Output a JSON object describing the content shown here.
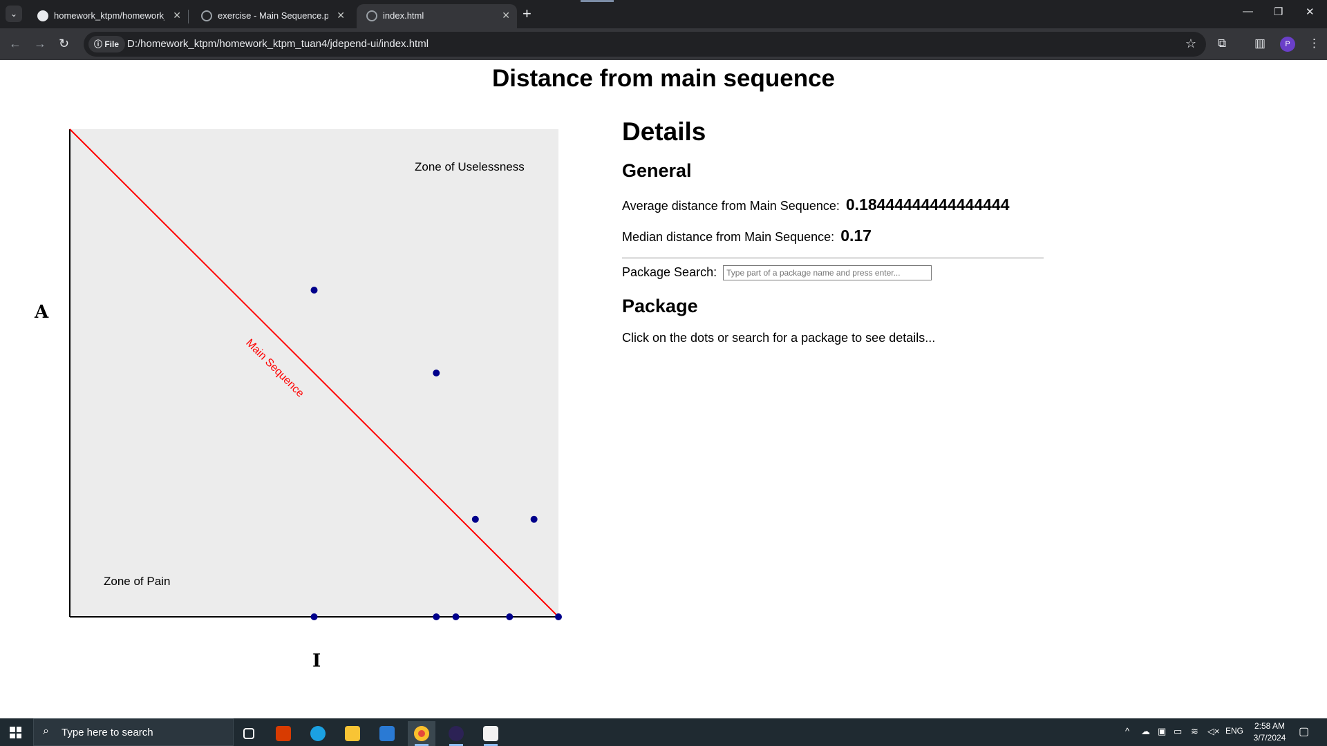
{
  "browser": {
    "tabs": [
      {
        "title": "homework_ktpm/homework_kt",
        "icon": "github-icon",
        "close": "✕"
      },
      {
        "title": "exercise - Main Sequence.pdf",
        "icon": "globe-icon",
        "close": "✕"
      },
      {
        "title": "index.html",
        "icon": "globe-icon",
        "close": "✕",
        "active": true
      }
    ],
    "new_tab": "+",
    "address": {
      "scheme_chip": "File",
      "url": "D:/homework_ktpm/homework_ktpm_tuan4/jdepend-ui/index.html"
    },
    "profile_initial": "P"
  },
  "page": {
    "title": "Distance from main sequence",
    "axis_y_label": "A",
    "axis_x_label": "I"
  },
  "chart_data": {
    "type": "scatter",
    "title": "",
    "xlabel": "I",
    "ylabel": "A",
    "xlim": [
      0,
      1
    ],
    "ylim": [
      0,
      1
    ],
    "grid": false,
    "background_color": "#ececec",
    "point_color": "#00008b",
    "line_color": "#ff0000",
    "annotations": [
      "Zone of Uselessness",
      "Zone of Pain",
      "Main Sequence"
    ],
    "reference_line": {
      "name": "Main Sequence",
      "from": [
        0,
        1
      ],
      "to": [
        1,
        0
      ]
    },
    "points": [
      {
        "x": 0.5,
        "y": 0.67
      },
      {
        "x": 0.75,
        "y": 0.5
      },
      {
        "x": 0.83,
        "y": 0.2
      },
      {
        "x": 0.95,
        "y": 0.2
      },
      {
        "x": 0.5,
        "y": 0.0
      },
      {
        "x": 0.75,
        "y": 0.0
      },
      {
        "x": 0.79,
        "y": 0.0
      },
      {
        "x": 0.9,
        "y": 0.0
      },
      {
        "x": 1.0,
        "y": 0.0
      }
    ]
  },
  "details": {
    "heading": "Details",
    "general_heading": "General",
    "avg_label": "Average distance from Main Sequence:",
    "avg_value": "0.18444444444444444",
    "median_label": "Median distance from Main Sequence:",
    "median_value": "0.17",
    "search_label": "Package Search:",
    "search_placeholder": "Type part of a package name and press enter...",
    "package_heading": "Package",
    "package_hint": "Click on the dots or search for a package to see details..."
  },
  "taskbar": {
    "search_placeholder": "Type here to search",
    "language": "ENG",
    "time": "2:58 AM",
    "date": "3/7/2024"
  }
}
